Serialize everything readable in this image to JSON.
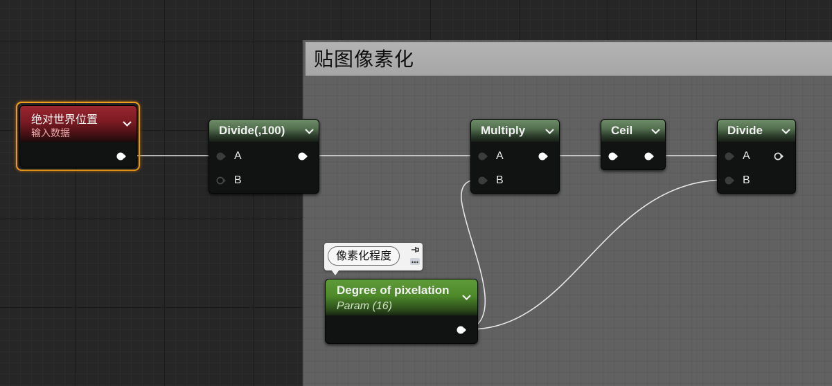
{
  "comment": {
    "title": "贴图像素化"
  },
  "nodes": {
    "absolute_world_position": {
      "title": "绝对世界位置",
      "subtitle": "输入数据"
    },
    "divide_100": {
      "title": "Divide(,100)",
      "pin_a": "A",
      "pin_b": "B"
    },
    "multiply": {
      "title": "Multiply",
      "pin_a": "A",
      "pin_b": "B"
    },
    "ceil": {
      "title": "Ceil"
    },
    "divide": {
      "title": "Divide",
      "pin_a": "A",
      "pin_b": "B"
    },
    "degree_of_pixelation": {
      "title": "Degree of pixelation",
      "subtitle": "Param (16)",
      "tooltip": "像素化程度"
    }
  },
  "colors": {
    "header_green": "#53704f",
    "param_green": "#4e8a2a",
    "input_red": "#8a1d24",
    "selection_orange": "#f0a020",
    "wire": "#e6e6e6"
  }
}
